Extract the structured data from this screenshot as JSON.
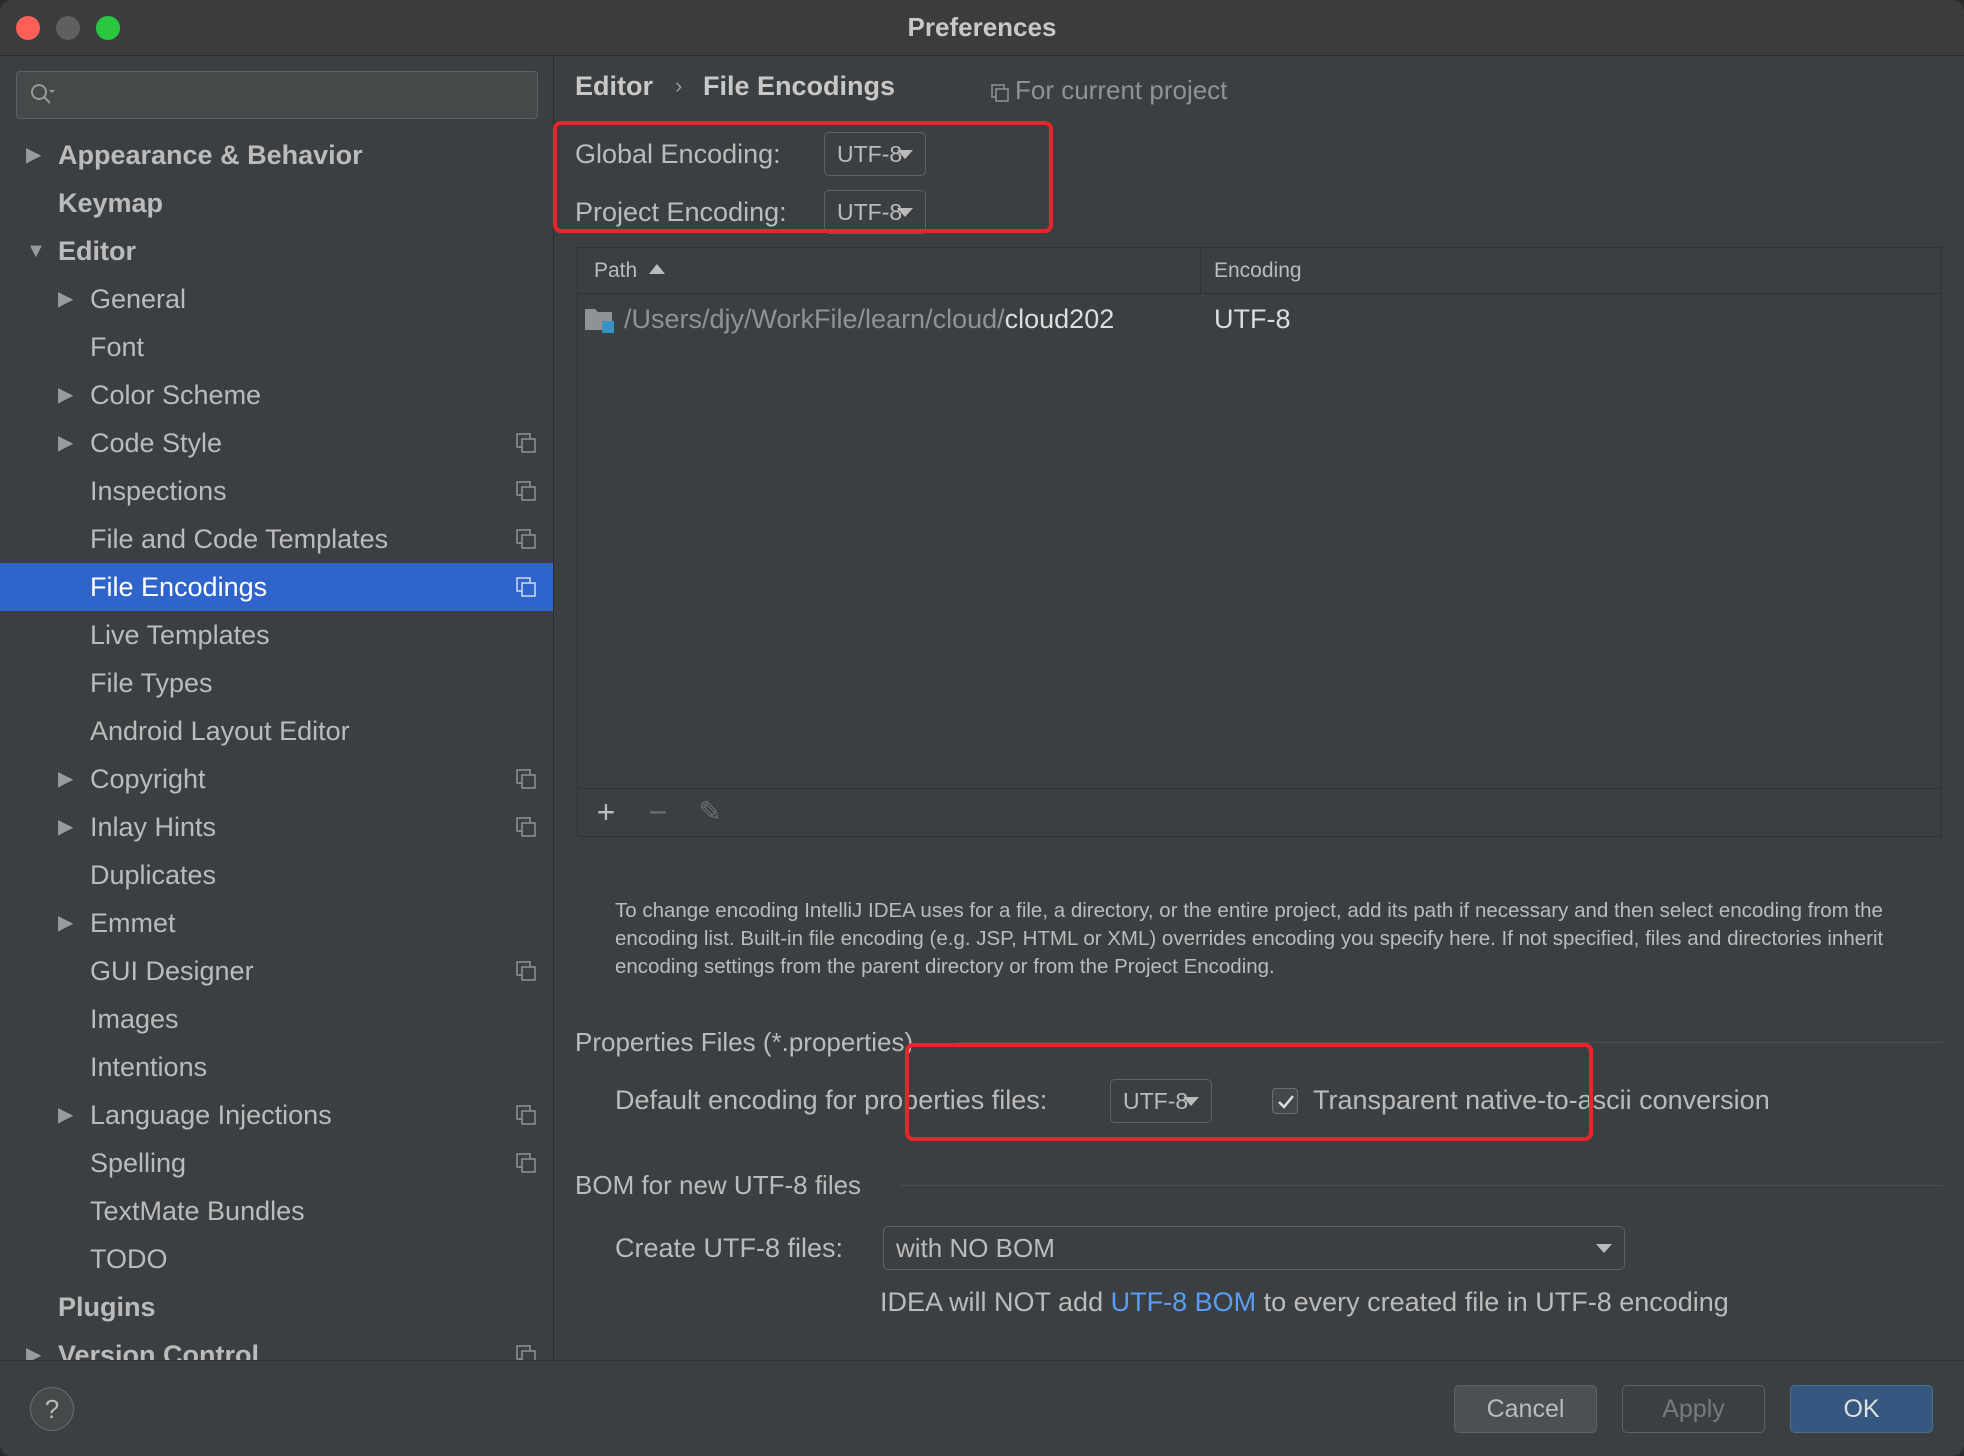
{
  "window": {
    "title": "Preferences"
  },
  "sidebar": {
    "search_placeholder": "",
    "items": [
      {
        "label": "Appearance & Behavior",
        "bold": true,
        "level": 0,
        "arrow": "right"
      },
      {
        "label": "Keymap",
        "bold": true,
        "level": 0,
        "arrow": ""
      },
      {
        "label": "Editor",
        "bold": true,
        "level": 0,
        "arrow": "down"
      },
      {
        "label": "General",
        "level": 1,
        "arrow": "right"
      },
      {
        "label": "Font",
        "level": 1,
        "arrow": ""
      },
      {
        "label": "Color Scheme",
        "level": 1,
        "arrow": "right"
      },
      {
        "label": "Code Style",
        "level": 1,
        "arrow": "right",
        "project": true
      },
      {
        "label": "Inspections",
        "level": 1,
        "arrow": "",
        "project": true
      },
      {
        "label": "File and Code Templates",
        "level": 1,
        "arrow": "",
        "project": true
      },
      {
        "label": "File Encodings",
        "level": 1,
        "arrow": "",
        "project": true,
        "selected": true
      },
      {
        "label": "Live Templates",
        "level": 1,
        "arrow": ""
      },
      {
        "label": "File Types",
        "level": 1,
        "arrow": ""
      },
      {
        "label": "Android Layout Editor",
        "level": 1,
        "arrow": ""
      },
      {
        "label": "Copyright",
        "level": 1,
        "arrow": "right",
        "project": true
      },
      {
        "label": "Inlay Hints",
        "level": 1,
        "arrow": "right",
        "project": true
      },
      {
        "label": "Duplicates",
        "level": 1,
        "arrow": ""
      },
      {
        "label": "Emmet",
        "level": 1,
        "arrow": "right"
      },
      {
        "label": "GUI Designer",
        "level": 1,
        "arrow": "",
        "project": true
      },
      {
        "label": "Images",
        "level": 1,
        "arrow": ""
      },
      {
        "label": "Intentions",
        "level": 1,
        "arrow": ""
      },
      {
        "label": "Language Injections",
        "level": 1,
        "arrow": "right",
        "project": true
      },
      {
        "label": "Spelling",
        "level": 1,
        "arrow": "",
        "project": true
      },
      {
        "label": "TextMate Bundles",
        "level": 1,
        "arrow": ""
      },
      {
        "label": "TODO",
        "level": 1,
        "arrow": ""
      },
      {
        "label": "Plugins",
        "bold": true,
        "level": 0,
        "arrow": ""
      },
      {
        "label": "Version Control",
        "bold": true,
        "level": 0,
        "arrow": "right",
        "project": true
      }
    ]
  },
  "breadcrumb": {
    "parent": "Editor",
    "separator": "›",
    "current": "File Encodings"
  },
  "scope_hint": "For current project",
  "encodings": {
    "global_label": "Global Encoding:",
    "global_value": "UTF-8",
    "project_label": "Project Encoding:",
    "project_value": "UTF-8"
  },
  "table": {
    "columns": [
      "Path",
      "Encoding"
    ],
    "rows": [
      {
        "path_prefix": "/Users/djy/WorkFile/learn/cloud/",
        "path_name": "cloud202",
        "encoding": "UTF-8"
      }
    ],
    "toolbar": {
      "add": "+",
      "remove": "−",
      "edit": "✎"
    }
  },
  "help_text": "To change encoding IntelliJ IDEA uses for a file, a directory, or the entire project, add its path if necessary and then select encoding from the encoding list. Built-in file encoding (e.g. JSP, HTML or XML) overrides encoding you specify here. If not specified, files and directories inherit encoding settings from the parent directory or from the Project Encoding.",
  "properties": {
    "section_title": "Properties Files (*.properties)",
    "default_label": "Default encoding for properties files:",
    "default_value": "UTF-8",
    "native_to_ascii_label": "Transparent native-to-ascii conversion",
    "native_to_ascii_checked": true
  },
  "bom": {
    "section_title": "BOM for new UTF-8 files",
    "create_label": "Create UTF-8 files:",
    "create_value": "with NO BOM",
    "note_before": "IDEA will NOT add ",
    "note_link": "UTF-8 BOM",
    "note_after": " to every created file in UTF-8 encoding"
  },
  "footer": {
    "help": "?",
    "cancel": "Cancel",
    "apply": "Apply",
    "ok": "OK"
  },
  "colors": {
    "selection": "#2f65ca",
    "highlight_box": "#e8262a",
    "link": "#589df6",
    "primary_button": "#365880"
  }
}
